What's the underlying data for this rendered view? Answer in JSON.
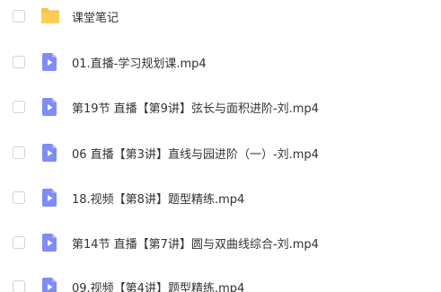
{
  "colors": {
    "folder": "#F9C440",
    "video": "#7F8CF4",
    "text": "#333333",
    "checkbox_border": "#CFD3DB"
  },
  "files": [
    {
      "name": "课堂笔记",
      "type": "folder",
      "icon": "folder-icon"
    },
    {
      "name": "01.直播-学习规划课.mp4",
      "type": "video",
      "icon": "video-file-icon"
    },
    {
      "name": "第19节 直播【第9讲】弦长与面积进阶-刘.mp4",
      "type": "video",
      "icon": "video-file-icon"
    },
    {
      "name": "06 直播【第3讲】直线与园进阶（一）-刘.mp4",
      "type": "video",
      "icon": "video-file-icon"
    },
    {
      "name": "18.视频【第8讲】题型精练.mp4",
      "type": "video",
      "icon": "video-file-icon"
    },
    {
      "name": "第14节 直播【第7讲】圆与双曲线综合-刘.mp4",
      "type": "video",
      "icon": "video-file-icon"
    },
    {
      "name": "09.视频【第4讲】题型精练.mp4",
      "type": "video",
      "icon": "video-file-icon"
    }
  ]
}
